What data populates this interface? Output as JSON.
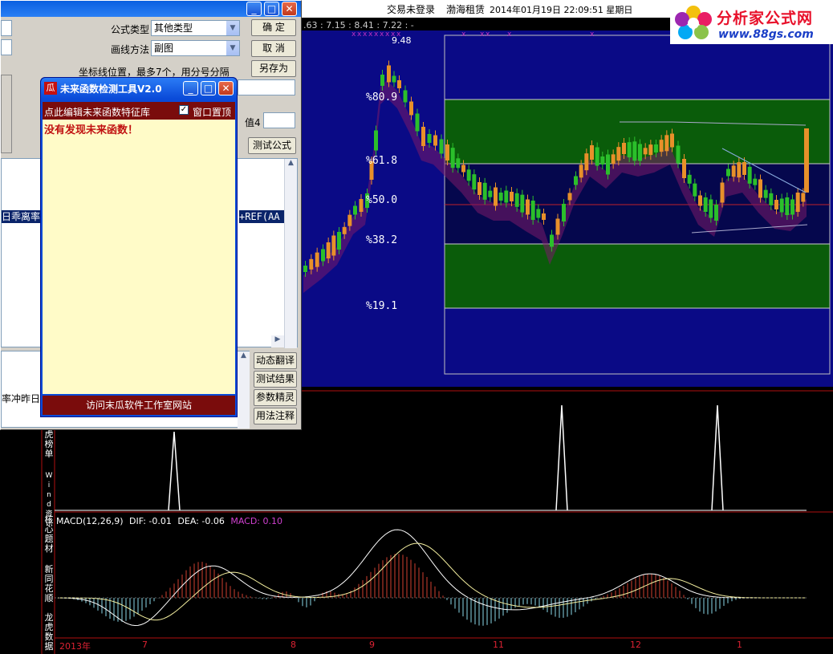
{
  "top_bar": {
    "price_readout": ".63 : 7.15 : 8.41 : 7.22 : -",
    "login_status": "交易未登录",
    "stock_name": "渤海租赁",
    "datetime": "2014年01月19日  22:09:51  星期日"
  },
  "logo": {
    "name": "分析家公式网",
    "url": "www.88gs.com"
  },
  "main_chart": {
    "peak_label": "9.48",
    "fib_levels": [
      "%80.9",
      "%61.8",
      "%50.0",
      "%38.2",
      "%19.1"
    ]
  },
  "indicator_panel": {
    "side_labels": [
      "虎榜单",
      "Wind资讯",
      "核心题材",
      "新同花顺",
      "龙虎数据"
    ]
  },
  "macd": {
    "name": "MACD(12,26,9)",
    "dif": "DIF: -0.01",
    "dea": "DEA: -0.06",
    "macd": "MACD: 0.10"
  },
  "time_axis": [
    "2013年",
    "7",
    "8",
    "9",
    "11",
    "12",
    "1"
  ],
  "colors": {
    "bull": "#e8902a",
    "bear": "#2bbf2b",
    "fib_band": "#0a5c0a",
    "chart_bg": "#0c0c8a"
  },
  "editor_window": {
    "formula_type_label": "公式类型",
    "formula_type_value": "其他类型",
    "draw_method_label": "画线方法",
    "draw_method_value": "副图",
    "ok_button": "确  定",
    "cancel_button": "取  消",
    "save_as_button": "另存为",
    "coords_hint": "坐标线位置，最多7个，用分号分隔",
    "value4_label": "值4",
    "test_formula_button": "测试公式",
    "code_fragment_left": "日乖离率",
    "code_fragment_right": "+REF(AA",
    "status_fragment": "率冲昨日王",
    "side_buttons": [
      "动态翻译",
      "测试结果",
      "参数精灵",
      "用法注释"
    ]
  },
  "future_tool": {
    "title": "未来函数检测工具V2.0",
    "icon_char": "瓜",
    "subheader": "点此编辑未来函数特征库",
    "pin_label": "窗口置顶",
    "pin_checked": true,
    "result": "没有发现未来函数！",
    "footer": "访问末瓜软件工作室网站"
  }
}
